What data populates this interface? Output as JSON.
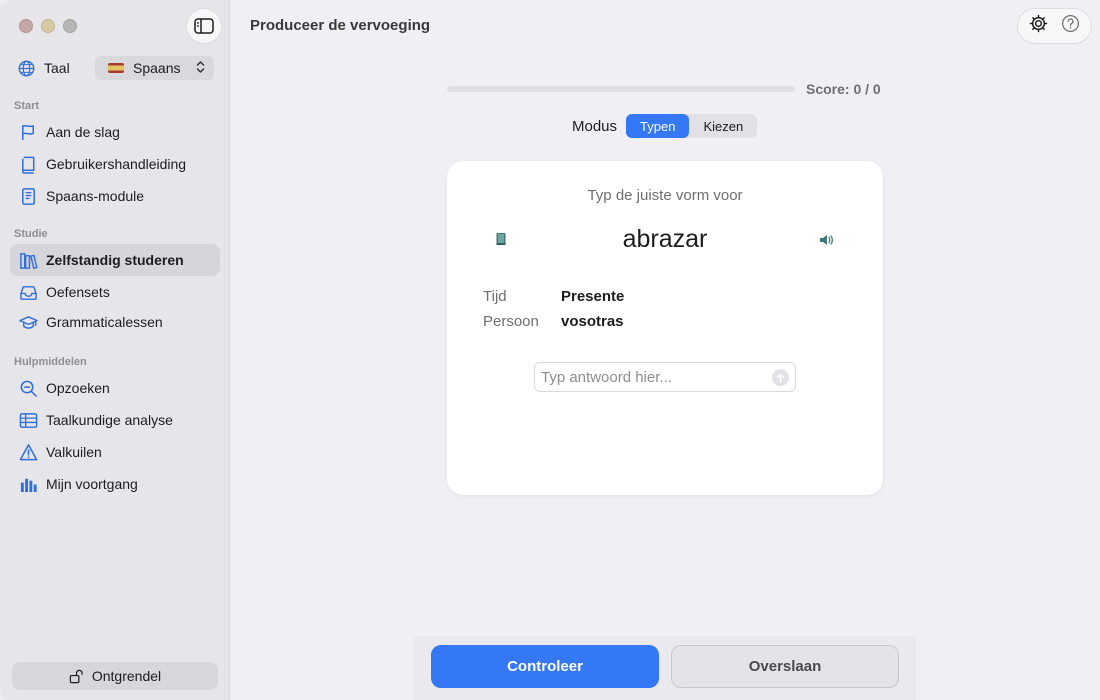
{
  "window": {
    "controls": [
      "close",
      "minimize",
      "zoom"
    ]
  },
  "sidebar": {
    "language": {
      "label": "Taal",
      "selected": "Spaans",
      "icon": "globe-icon"
    },
    "sections": [
      {
        "title": "Start",
        "items": [
          {
            "label": "Aan de slag",
            "icon": "flag-icon"
          },
          {
            "label": "Gebruikershandleiding",
            "icon": "book-icon"
          },
          {
            "label": "Spaans-module",
            "icon": "document-icon"
          }
        ]
      },
      {
        "title": "Studie",
        "items": [
          {
            "label": "Zelfstandig studeren",
            "icon": "books-icon",
            "active": true
          },
          {
            "label": "Oefensets",
            "icon": "tray-icon"
          },
          {
            "label": "Grammaticalessen",
            "icon": "graduation-cap-icon"
          }
        ]
      },
      {
        "title": "Hulpmiddelen",
        "items": [
          {
            "label": "Opzoeken",
            "icon": "magnifier-icon"
          },
          {
            "label": "Taalkundige analyse",
            "icon": "table-icon"
          },
          {
            "label": "Valkuilen",
            "icon": "warning-icon"
          },
          {
            "label": "Mijn voortgang",
            "icon": "bar-chart-icon"
          }
        ]
      }
    ],
    "unlock_label": "Ontgrendel"
  },
  "header": {
    "title": "Produceer de vervoeging"
  },
  "progress": {
    "fraction": 0,
    "score_text": "Score: 0 / 0"
  },
  "mode": {
    "label": "Modus",
    "options": [
      "Typen",
      "Kiezen"
    ],
    "selected": "Typen"
  },
  "card": {
    "prompt": "Typ de juiste vorm voor",
    "verb": "abrazar",
    "tense_label": "Tijd",
    "tense_value": "Presente",
    "person_label": "Persoon",
    "person_value": "vosotras",
    "answer_placeholder": "Typ antwoord hier...",
    "answer_value": ""
  },
  "actions": {
    "check_label": "Controleer",
    "skip_label": "Overslaan"
  },
  "colors": {
    "accent": "#3478f6",
    "sidebar_bg": "#e6e6ea",
    "content_bg": "#f0f0f4",
    "icon_blue": "#2f6fdb"
  }
}
